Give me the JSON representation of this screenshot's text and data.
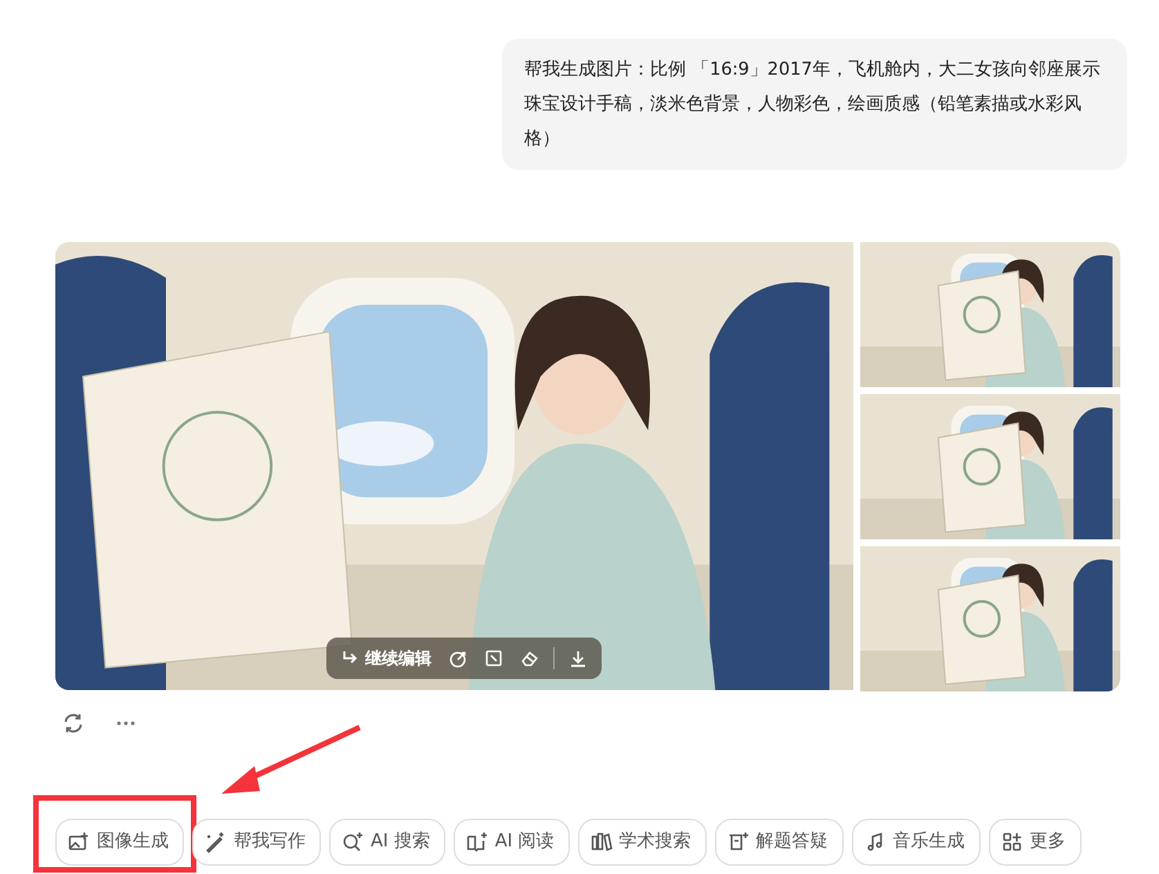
{
  "prompt": {
    "text": "帮我生成图片：比例 「16:9」2017年，飞机舱内，大二女孩向邻座展示珠宝设计手稿，淡米色背景，人物彩色，绘画质感（铅笔素描或水彩风格）"
  },
  "image_toolbar": {
    "edit_label": "继续编辑"
  },
  "chips": [
    {
      "label": "图像生成",
      "highlighted": true
    },
    {
      "label": "帮我写作",
      "highlighted": false
    },
    {
      "label": "AI 搜索",
      "highlighted": false
    },
    {
      "label": "AI 阅读",
      "highlighted": false
    },
    {
      "label": "学术搜索",
      "highlighted": false
    },
    {
      "label": "解题答疑",
      "highlighted": false
    },
    {
      "label": "音乐生成",
      "highlighted": false
    },
    {
      "label": "更多",
      "highlighted": false
    }
  ]
}
